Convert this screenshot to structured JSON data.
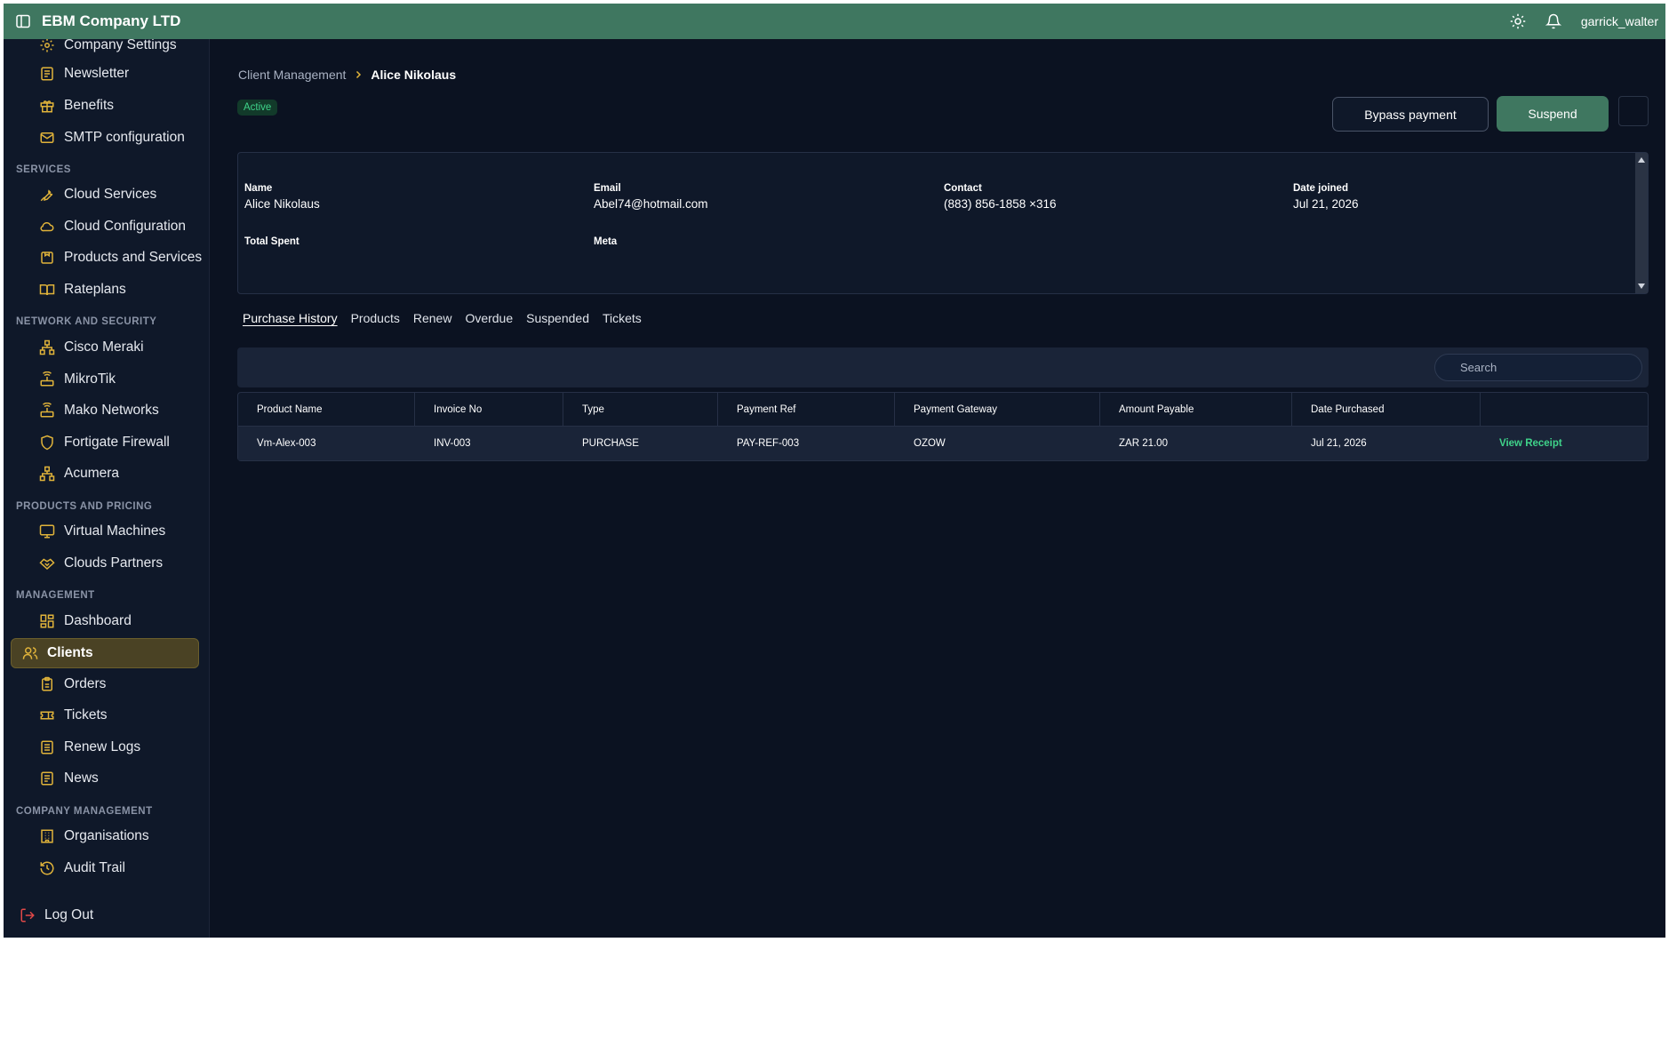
{
  "app": {
    "company": "EBM Company LTD",
    "user": "garrick_walter"
  },
  "sidebar": {
    "top_items": [
      "Company Settings",
      "Newsletter",
      "Benefits",
      "SMTP configuration"
    ],
    "sections": [
      {
        "title": "SERVICES",
        "items": [
          "Cloud Services",
          "Cloud Configuration",
          "Products and Services",
          "Rateplans"
        ]
      },
      {
        "title": "NETWORK AND SECURITY",
        "items": [
          "Cisco Meraki",
          "MikroTik",
          "Mako Networks",
          "Fortigate Firewall",
          "Acumera"
        ]
      },
      {
        "title": "PRODUCTS AND PRICING",
        "items": [
          "Virtual Machines",
          "Clouds Partners"
        ]
      },
      {
        "title": "MANAGEMENT",
        "items": [
          "Dashboard",
          "Clients",
          "Orders",
          "Tickets",
          "Renew Logs",
          "News"
        ]
      },
      {
        "title": "COMPANY MANAGEMENT",
        "items": [
          "Organisations",
          "Audit Trail"
        ]
      }
    ],
    "logout": "Log Out"
  },
  "breadcrumb": {
    "parent": "Client Management",
    "current": "Alice Nikolaus"
  },
  "status": "Active",
  "actions": {
    "bypass": "Bypass payment",
    "suspend": "Suspend"
  },
  "client": {
    "name_label": "Name",
    "name": "Alice Nikolaus",
    "email_label": "Email",
    "email": "Abel74@hotmail.com",
    "contact_label": "Contact",
    "contact": "(883) 856-1858 ×316",
    "joined_label": "Date joined",
    "joined": "Jul 21, 2026",
    "spent_label": "Total Spent",
    "meta_label": "Meta"
  },
  "tabs": [
    "Purchase History",
    "Products",
    "Renew",
    "Overdue",
    "Suspended",
    "Tickets"
  ],
  "search": {
    "placeholder": "Search"
  },
  "table": {
    "headers": [
      "Product Name",
      "Invoice No",
      "Type",
      "Payment Ref",
      "Payment Gateway",
      "Amount Payable",
      "Date Purchased",
      ""
    ],
    "rows": [
      [
        "Vm-Alex-003",
        "INV-003",
        "PURCHASE",
        "PAY-REF-003",
        "OZOW",
        "ZAR 21.00",
        "Jul 21, 2026",
        "View Receipt"
      ]
    ]
  }
}
